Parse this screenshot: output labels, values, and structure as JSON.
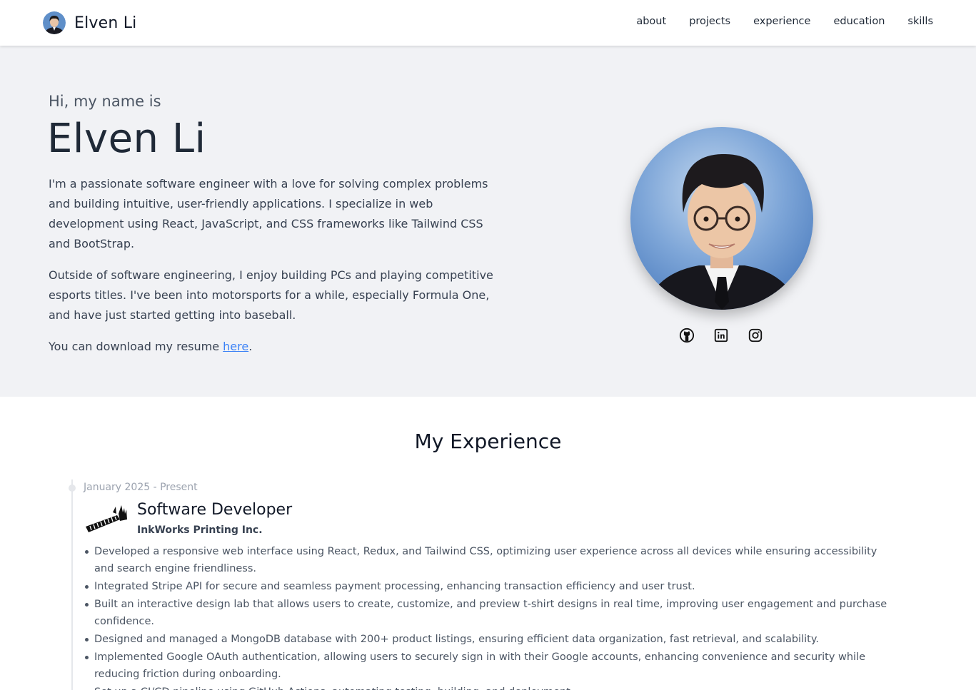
{
  "nav": {
    "brand_name": "Elven Li",
    "links": [
      "about",
      "projects",
      "experience",
      "education",
      "skills"
    ]
  },
  "hero": {
    "greeting": "Hi, my name is",
    "name": "Elven Li",
    "paragraph1": "I'm a passionate software engineer with a love for solving complex problems and building intuitive, user-friendly applications. I specialize in web development using React, JavaScript, and CSS frameworks like Tailwind CSS and BootStrap.",
    "paragraph2": "Outside of software engineering, I enjoy building PCs and playing competitive esports titles. I've been into motorsports for a while, especially Formula One, and have just started getting into baseball.",
    "resume_prefix": "You can download my resume ",
    "resume_link": "here",
    "resume_suffix": ".",
    "socials": [
      "github-icon",
      "linkedin-icon",
      "instagram-icon"
    ]
  },
  "experience": {
    "title": "My Experience",
    "jobs": [
      {
        "date": "January 2025 - Present",
        "title": "Software Developer",
        "company": "InkWorks Printing Inc.",
        "bullets": [
          "Developed a responsive web interface using React, Redux, and Tailwind CSS, optimizing user experience across all devices while ensuring accessibility and search engine friendliness.",
          "Integrated Stripe API for secure and seamless payment processing, enhancing transaction efficiency and user trust.",
          "Built an interactive design lab that allows users to create, customize, and preview t-shirt designs in real time, improving user engagement and purchase confidence.",
          "Designed and managed a MongoDB database with 200+ product listings, ensuring efficient data organization, fast retrieval, and scalability.",
          "Implemented Google OAuth authentication, allowing users to securely sign in with their Google accounts, enhancing convenience and security while reducing friction during onboarding.",
          "Set up a CI/CD pipeline using GitHub Actions, automating testing, building, and deployment."
        ]
      }
    ]
  },
  "colors": {
    "hero_bg": "#f1f2f5",
    "link": "#3b82f6",
    "timeline": "#e5e7eb"
  }
}
